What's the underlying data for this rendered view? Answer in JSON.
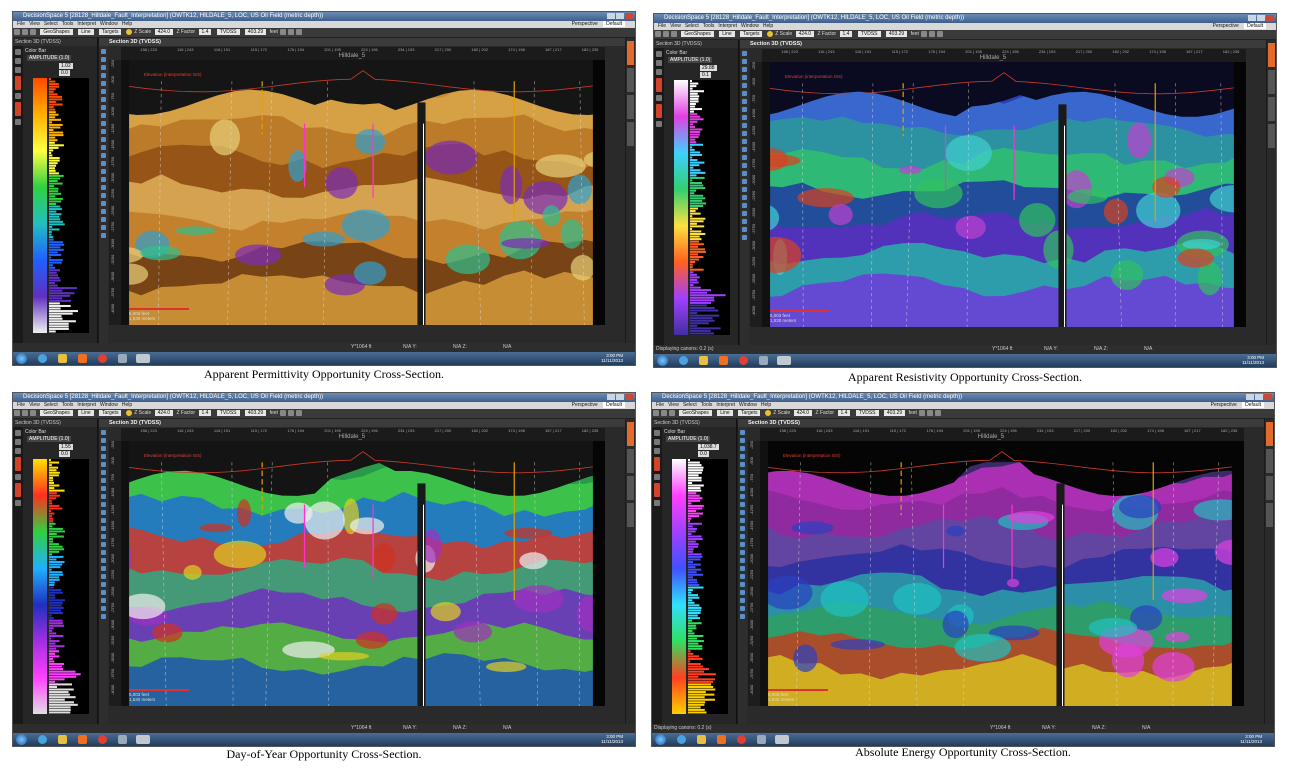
{
  "window": {
    "title": "DecisionSpace 5 [28128_Hilldale_Fault_Interpretation] (OWTK12, HILDALE_5, LOC, US Oil Field (metric depth))",
    "menu": [
      "File",
      "View",
      "Select",
      "Tools",
      "Interpret",
      "Window",
      "Help"
    ],
    "perspective_label": "Perspective",
    "perspective_value": "Default",
    "toolbar": {
      "field_geoshapes": "GeoShapes",
      "field_line": "Line",
      "field_targets": "Targets",
      "z_scale_label": "Z Scale",
      "z_scale_value": "424.0",
      "z_factor_label": "Z Factor",
      "z_factor_value": "1.4",
      "tvdss": "TVDSS",
      "depth_value": "403.29",
      "depth_unit": "feet"
    },
    "left_pane_title": "Section 3D (TVDSS)",
    "color_bar_title": "Color Bar",
    "amplitude_label": "AMPLITUDE (1.0)",
    "section_title": "Section 3D (TVDSS)",
    "well_name": "Hilldale_5",
    "horizon_label": "Elevation (interpretation ISS)",
    "scale_feet": "5,003 feet",
    "scale_meters": "1,530 meters",
    "status": {
      "readout": "Y*1064 ft",
      "na_y": "N/A  Y:",
      "na_z": "N/A  Z:",
      "na": "N/A"
    },
    "status_displaying": "Displaying canons: 0.2 (s)",
    "clock_time": "3:00 PM",
    "clock_date": "11/11/2013",
    "x_ticks": [
      "158 | 223",
      "116 | 243",
      "116 | 191",
      "115 | 172",
      "176 | 194",
      "201 | 195",
      "224 | 196",
      "234 | 193",
      "217 | 200",
      "182 | 202",
      "174 | 198",
      "167 | 217",
      "182 | 235"
    ],
    "y_ticks": [
      "-250",
      "-500",
      "-750",
      "-1000",
      "-1250",
      "-1500",
      "-1750",
      "-2000",
      "-2250",
      "-2500",
      "-2750",
      "-3000",
      "-3250",
      "-3500",
      "-3750",
      "-4000"
    ],
    "panels": [
      {
        "caption": "Apparent Permittivity Opportunity Cross-Section.",
        "cb_max": "1.02",
        "cb_min": "0.0"
      },
      {
        "caption": "Apparent Resistivity Opportunity Cross-Section.",
        "cb_max": "29.88",
        "cb_min": "0.1"
      },
      {
        "caption": "Day-of-Year Opportunity Cross-Section.",
        "cb_max": "1.55",
        "cb_min": "0.0"
      },
      {
        "caption": "Absolute Energy Opportunity Cross-Section.",
        "cb_max": "1,038.7",
        "cb_min": "0.0"
      }
    ],
    "colors": {
      "accent_orange": "#e26a2c",
      "well_magenta": "#ff33cc",
      "well_yellow": "#e0a000",
      "horizon_red": "#c83a2a"
    }
  }
}
